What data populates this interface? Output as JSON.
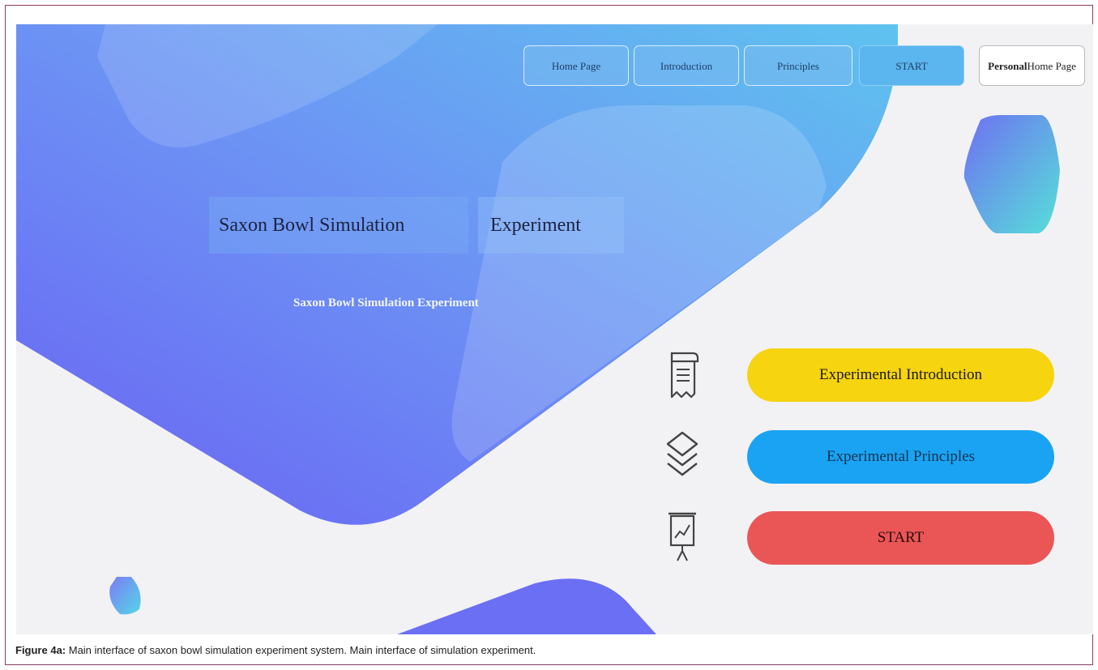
{
  "nav": {
    "home": "Home Page",
    "introduction": "Introduction",
    "principles": "Principles",
    "start": "START",
    "personal_line1": "Personal",
    "personal_line2": "Home Page"
  },
  "hero": {
    "title_part1": "Saxon Bowl Simulation",
    "title_part2": "Experiment",
    "subtitle": "Saxon Bowl Simulation Experiment"
  },
  "menu": {
    "intro_label": "Experimental Introduction",
    "principles_label": "Experimental Principles",
    "start_label": "START",
    "icons": [
      "scroll-document-icon",
      "layers-icon",
      "presentation-chart-icon"
    ]
  },
  "caption": {
    "label": "Figure 4a:",
    "text": " Main interface of saxon bowl simulation experiment system. Main interface of simulation experiment."
  },
  "colors": {
    "yellow_pill": "#f6d40f",
    "blue_pill": "#1aa3f2",
    "red_pill": "#ea5656",
    "gradient_start": "#6a6cf6",
    "gradient_end": "#5cc0f0"
  }
}
